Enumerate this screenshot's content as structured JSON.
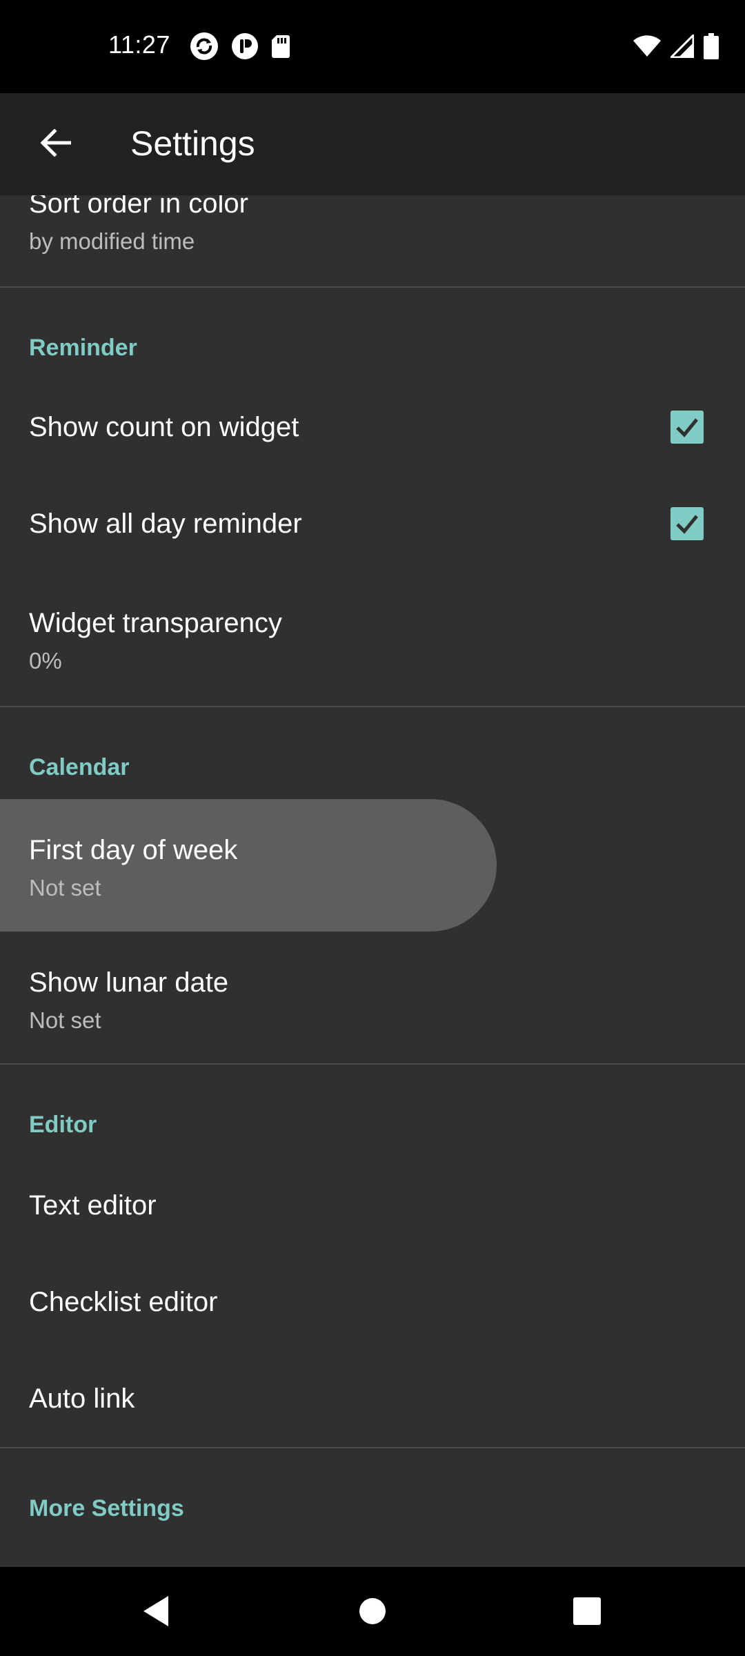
{
  "status_bar": {
    "time": "11:27",
    "left_icons": [
      "sync-icon",
      "pocket-icon",
      "sd-card-icon"
    ],
    "right_icons": [
      "wifi-icon",
      "signal-icon",
      "battery-icon"
    ]
  },
  "app_bar": {
    "title": "Settings",
    "back_icon": "arrow-left-icon"
  },
  "settings": {
    "sort_order": {
      "title": "Sort order in color",
      "summary": "by modified time"
    },
    "reminder": {
      "header": "Reminder",
      "show_count": {
        "title": "Show count on widget",
        "checked": true
      },
      "show_all_day": {
        "title": "Show all day reminder",
        "checked": true
      },
      "transparency": {
        "title": "Widget transparency",
        "summary": "0%"
      }
    },
    "calendar": {
      "header": "Calendar",
      "first_day": {
        "title": "First day of week",
        "summary": "Not set"
      },
      "lunar": {
        "title": "Show lunar date",
        "summary": "Not set"
      }
    },
    "editor": {
      "header": "Editor",
      "text_editor": {
        "title": "Text editor"
      },
      "checklist_editor": {
        "title": "Checklist editor"
      },
      "auto_link": {
        "title": "Auto link"
      }
    },
    "more": {
      "header": "More Settings"
    }
  },
  "colors": {
    "accent": "#80cbc4",
    "background": "#303030",
    "app_bar": "#212121"
  },
  "nav_bar": {
    "icons": [
      "back-triangle-icon",
      "home-circle-icon",
      "recents-square-icon"
    ]
  }
}
